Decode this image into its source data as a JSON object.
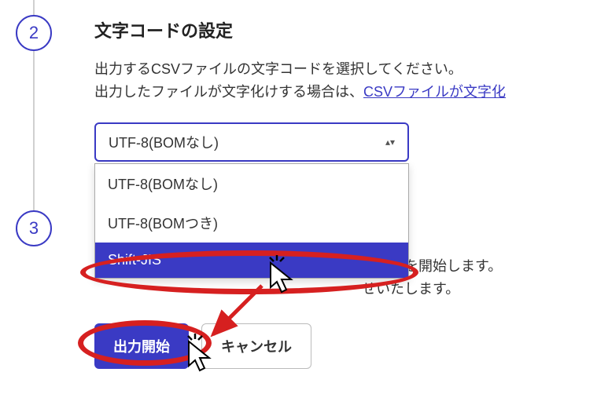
{
  "steps": {
    "step2": "2",
    "step3": "3"
  },
  "section": {
    "title": "文字コードの設定",
    "desc_line1": "出力するCSVファイルの文字コードを選択してください。",
    "desc_line2_prefix": "出力したファイルが文字化けする場合は、",
    "desc_link": "CSVファイルが文字化"
  },
  "select": {
    "current": "UTF-8(BOMなし)",
    "options": {
      "opt1": "UTF-8(BOMなし)",
      "opt2": "UTF-8(BOMつき)",
      "opt3": "Shift-JIS"
    }
  },
  "body": {
    "line1_suffix": "力処理を開始します。",
    "line2_suffix": "せいたします。"
  },
  "buttons": {
    "primary": "出力開始",
    "secondary": "キャンセル"
  }
}
